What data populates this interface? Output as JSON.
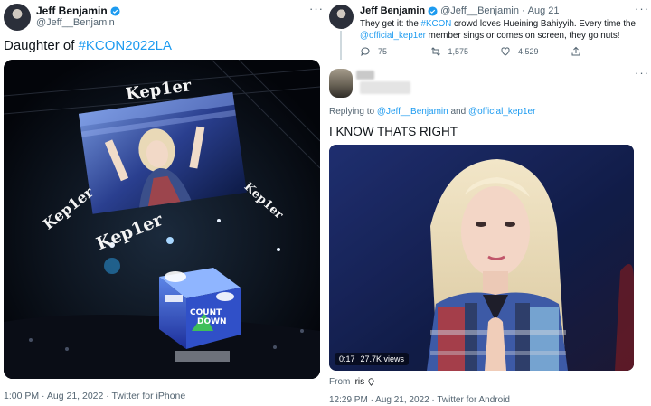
{
  "left_tweet": {
    "author_name": "Jeff Benjamin",
    "author_handle": "@Jeff__Benjamin",
    "text_prefix": "Daughter of ",
    "hashtag": "#KCON2022LA",
    "time": "1:00 PM",
    "date": "Aug 21, 2022",
    "source": "Twitter for iPhone",
    "media": {
      "big_screen_text": "Kep1er",
      "side_text_left": "Kep1er",
      "side_text_right": "Kep1er",
      "lower_text": "Kep1er",
      "cube_text_1": "COUNT",
      "cube_text_2": "DOWN"
    }
  },
  "right_tweet": {
    "author_name": "Jeff Benjamin",
    "author_handle": "@Jeff__Benjamin",
    "date": "Aug 21",
    "text_part1": "They get it: the ",
    "hashtag": "#KCON",
    "text_part2": " crowd loves Hueining Bahiyyih. Every time the ",
    "mention": "@official_kep1er",
    "text_part3": " member sings or comes on screen, they go nuts!",
    "replies": "75",
    "retweets": "1,575",
    "likes": "4,529",
    "reply": {
      "replying_to_prefix": "Replying to ",
      "replying_to_1": "@Jeff__Benjamin",
      "replying_to_and": " and ",
      "replying_to_2": "@official_kep1er",
      "text": "I KNOW THATS RIGHT",
      "video_time": "0:17",
      "video_views": "27.7K views",
      "from_prefix": "From ",
      "from_name": "iris",
      "time": "12:29 PM",
      "date": "Aug 21, 2022",
      "source": "Twitter for Android"
    }
  },
  "colors": {
    "link": "#1d9bf0",
    "muted": "#536471"
  }
}
